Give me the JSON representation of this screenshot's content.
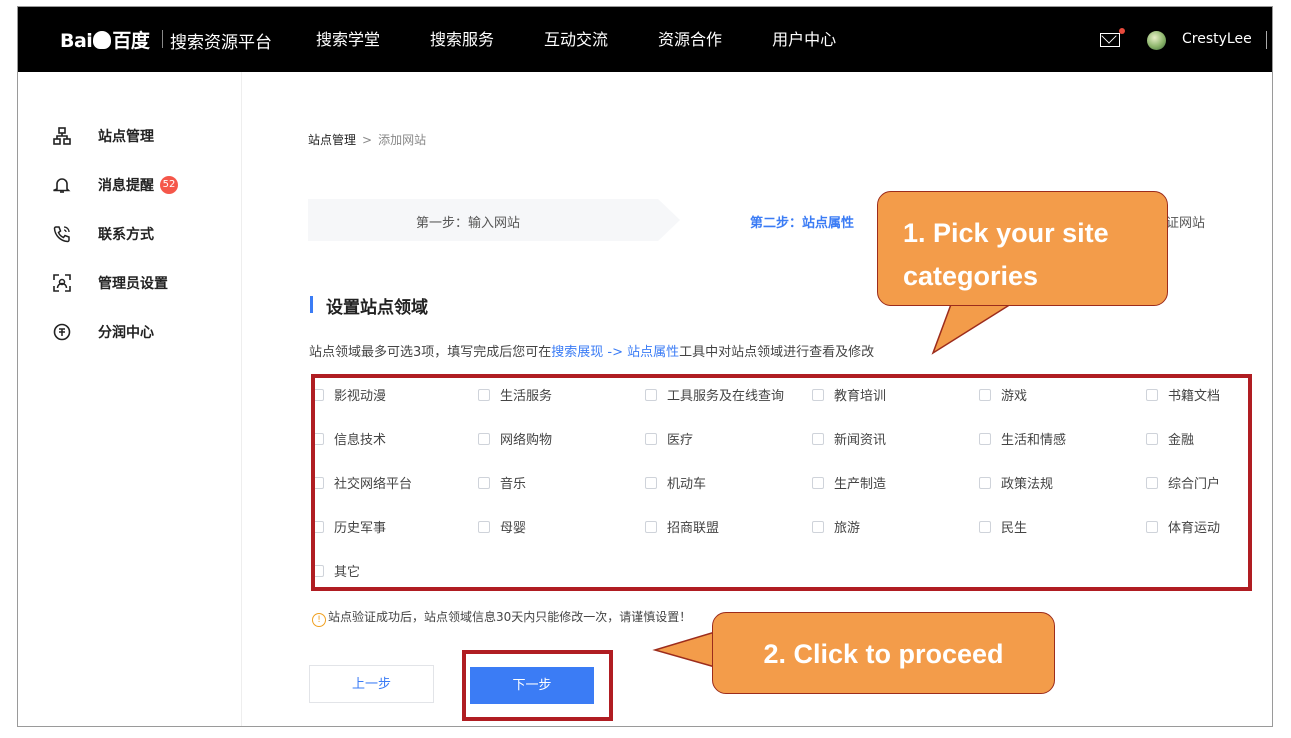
{
  "header": {
    "logo": "Bai百度",
    "platform": "搜索资源平台",
    "nav": [
      "搜索学堂",
      "搜索服务",
      "互动交流",
      "资源合作",
      "用户中心"
    ],
    "username": "CrestyLee"
  },
  "sidebar": {
    "items": [
      {
        "label": "站点管理",
        "icon": "sitemap-icon"
      },
      {
        "label": "消息提醒",
        "icon": "bell-icon",
        "badge": "52"
      },
      {
        "label": "联系方式",
        "icon": "phone-icon"
      },
      {
        "label": "管理员设置",
        "icon": "admin-icon"
      },
      {
        "label": "分润中心",
        "icon": "revenue-icon"
      }
    ]
  },
  "breadcrumb": {
    "root": "站点管理",
    "arrow": ">",
    "current": "添加网站"
  },
  "steps": {
    "step1": "第一步：输入网站",
    "step2": "第二步：站点属性",
    "step3": "证网站"
  },
  "section": {
    "title": "设置站点领域",
    "desc_prefix": "站点领域最多可选3项，填写完成后您可在",
    "desc_link1": "搜索展现",
    "desc_arrow": " -> ",
    "desc_link2": "站点属性",
    "desc_suffix": "工具中对站点领域进行查看及修改"
  },
  "categories": [
    "影视动漫",
    "生活服务",
    "工具服务及在线查询",
    "教育培训",
    "游戏",
    "书籍文档",
    "信息技术",
    "网络购物",
    "医疗",
    "新闻资讯",
    "生活和情感",
    "金融",
    "社交网络平台",
    "音乐",
    "机动车",
    "生产制造",
    "政策法规",
    "综合门户",
    "历史军事",
    "母婴",
    "招商联盟",
    "旅游",
    "民生",
    "体育运动",
    "其它"
  ],
  "note": "站点验证成功后，站点领域信息30天内只能修改一次，请谨慎设置！",
  "buttons": {
    "prev": "上一步",
    "next": "下一步"
  },
  "callouts": {
    "pick": "1. Pick your site categories",
    "proceed": "2. Click to proceed"
  },
  "colors": {
    "accent": "#3b7cf5",
    "callout": "#f39c4a",
    "highlight": "#b01d22",
    "badge": "#f5574a"
  }
}
